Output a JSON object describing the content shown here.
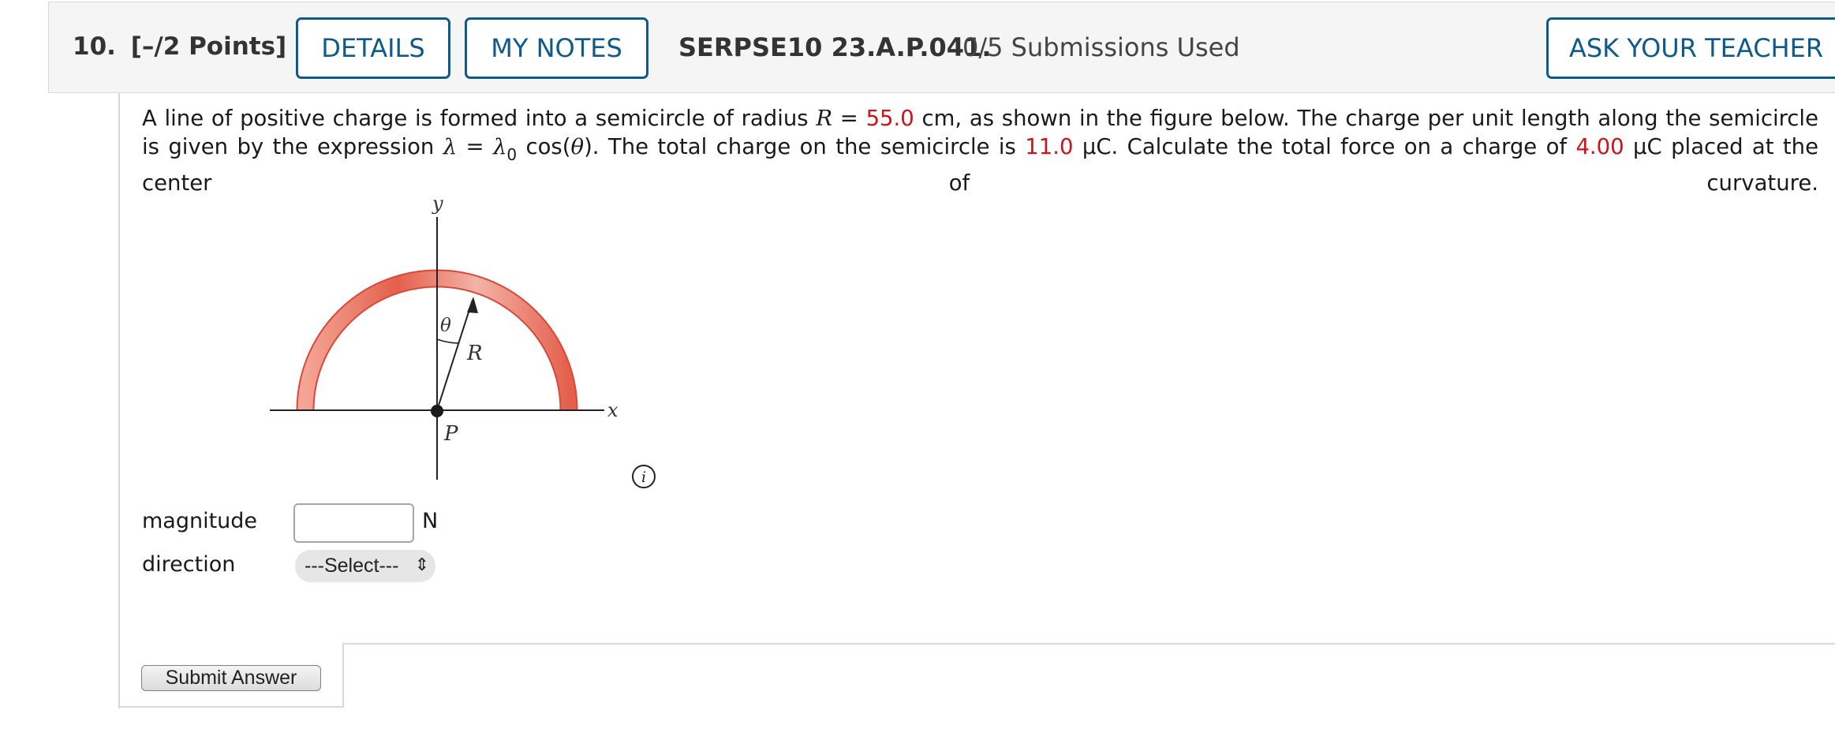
{
  "header": {
    "question_number": "10.",
    "points": "[–/2 Points]",
    "details_label": "DETAILS",
    "notes_label": "MY NOTES",
    "question_id": "SERPSE10 23.A.P.041.",
    "submissions": "0/5 Submissions Used",
    "ask_label": "ASK YOUR TEACHER",
    "accent_color": "#0e5a8a"
  },
  "problem": {
    "t1": "A line of positive charge is formed into a semicircle of radius ",
    "var_R": "R",
    "t2": " = ",
    "radius": "55.0",
    "t3": " cm, as shown in the figure below. The charge per unit length along the semicircle is given",
    "t4": "by the expression ",
    "lambda": "λ",
    "t5": " = ",
    "lambda0": "λ",
    "sub0": "0",
    "t6": " cos(",
    "theta": "θ",
    "t7": "). The total charge on the semicircle is ",
    "total_charge": "11.0",
    "t8": " μC. Calculate the total force on a charge of ",
    "point_charge": "4.00",
    "t9": " μC placed at the center of curvature.",
    "highlight_color": "#d0121b"
  },
  "figure": {
    "y_label": "y",
    "x_label": "x",
    "theta_label": "θ",
    "r_label": "R",
    "p_label": "P"
  },
  "answers": {
    "magnitude_label": "magnitude",
    "magnitude_value": "",
    "magnitude_unit": "N",
    "direction_label": "direction",
    "direction_selected": "---Select---"
  },
  "submit_label": "Submit Answer",
  "info_icon": "info-circle-icon"
}
